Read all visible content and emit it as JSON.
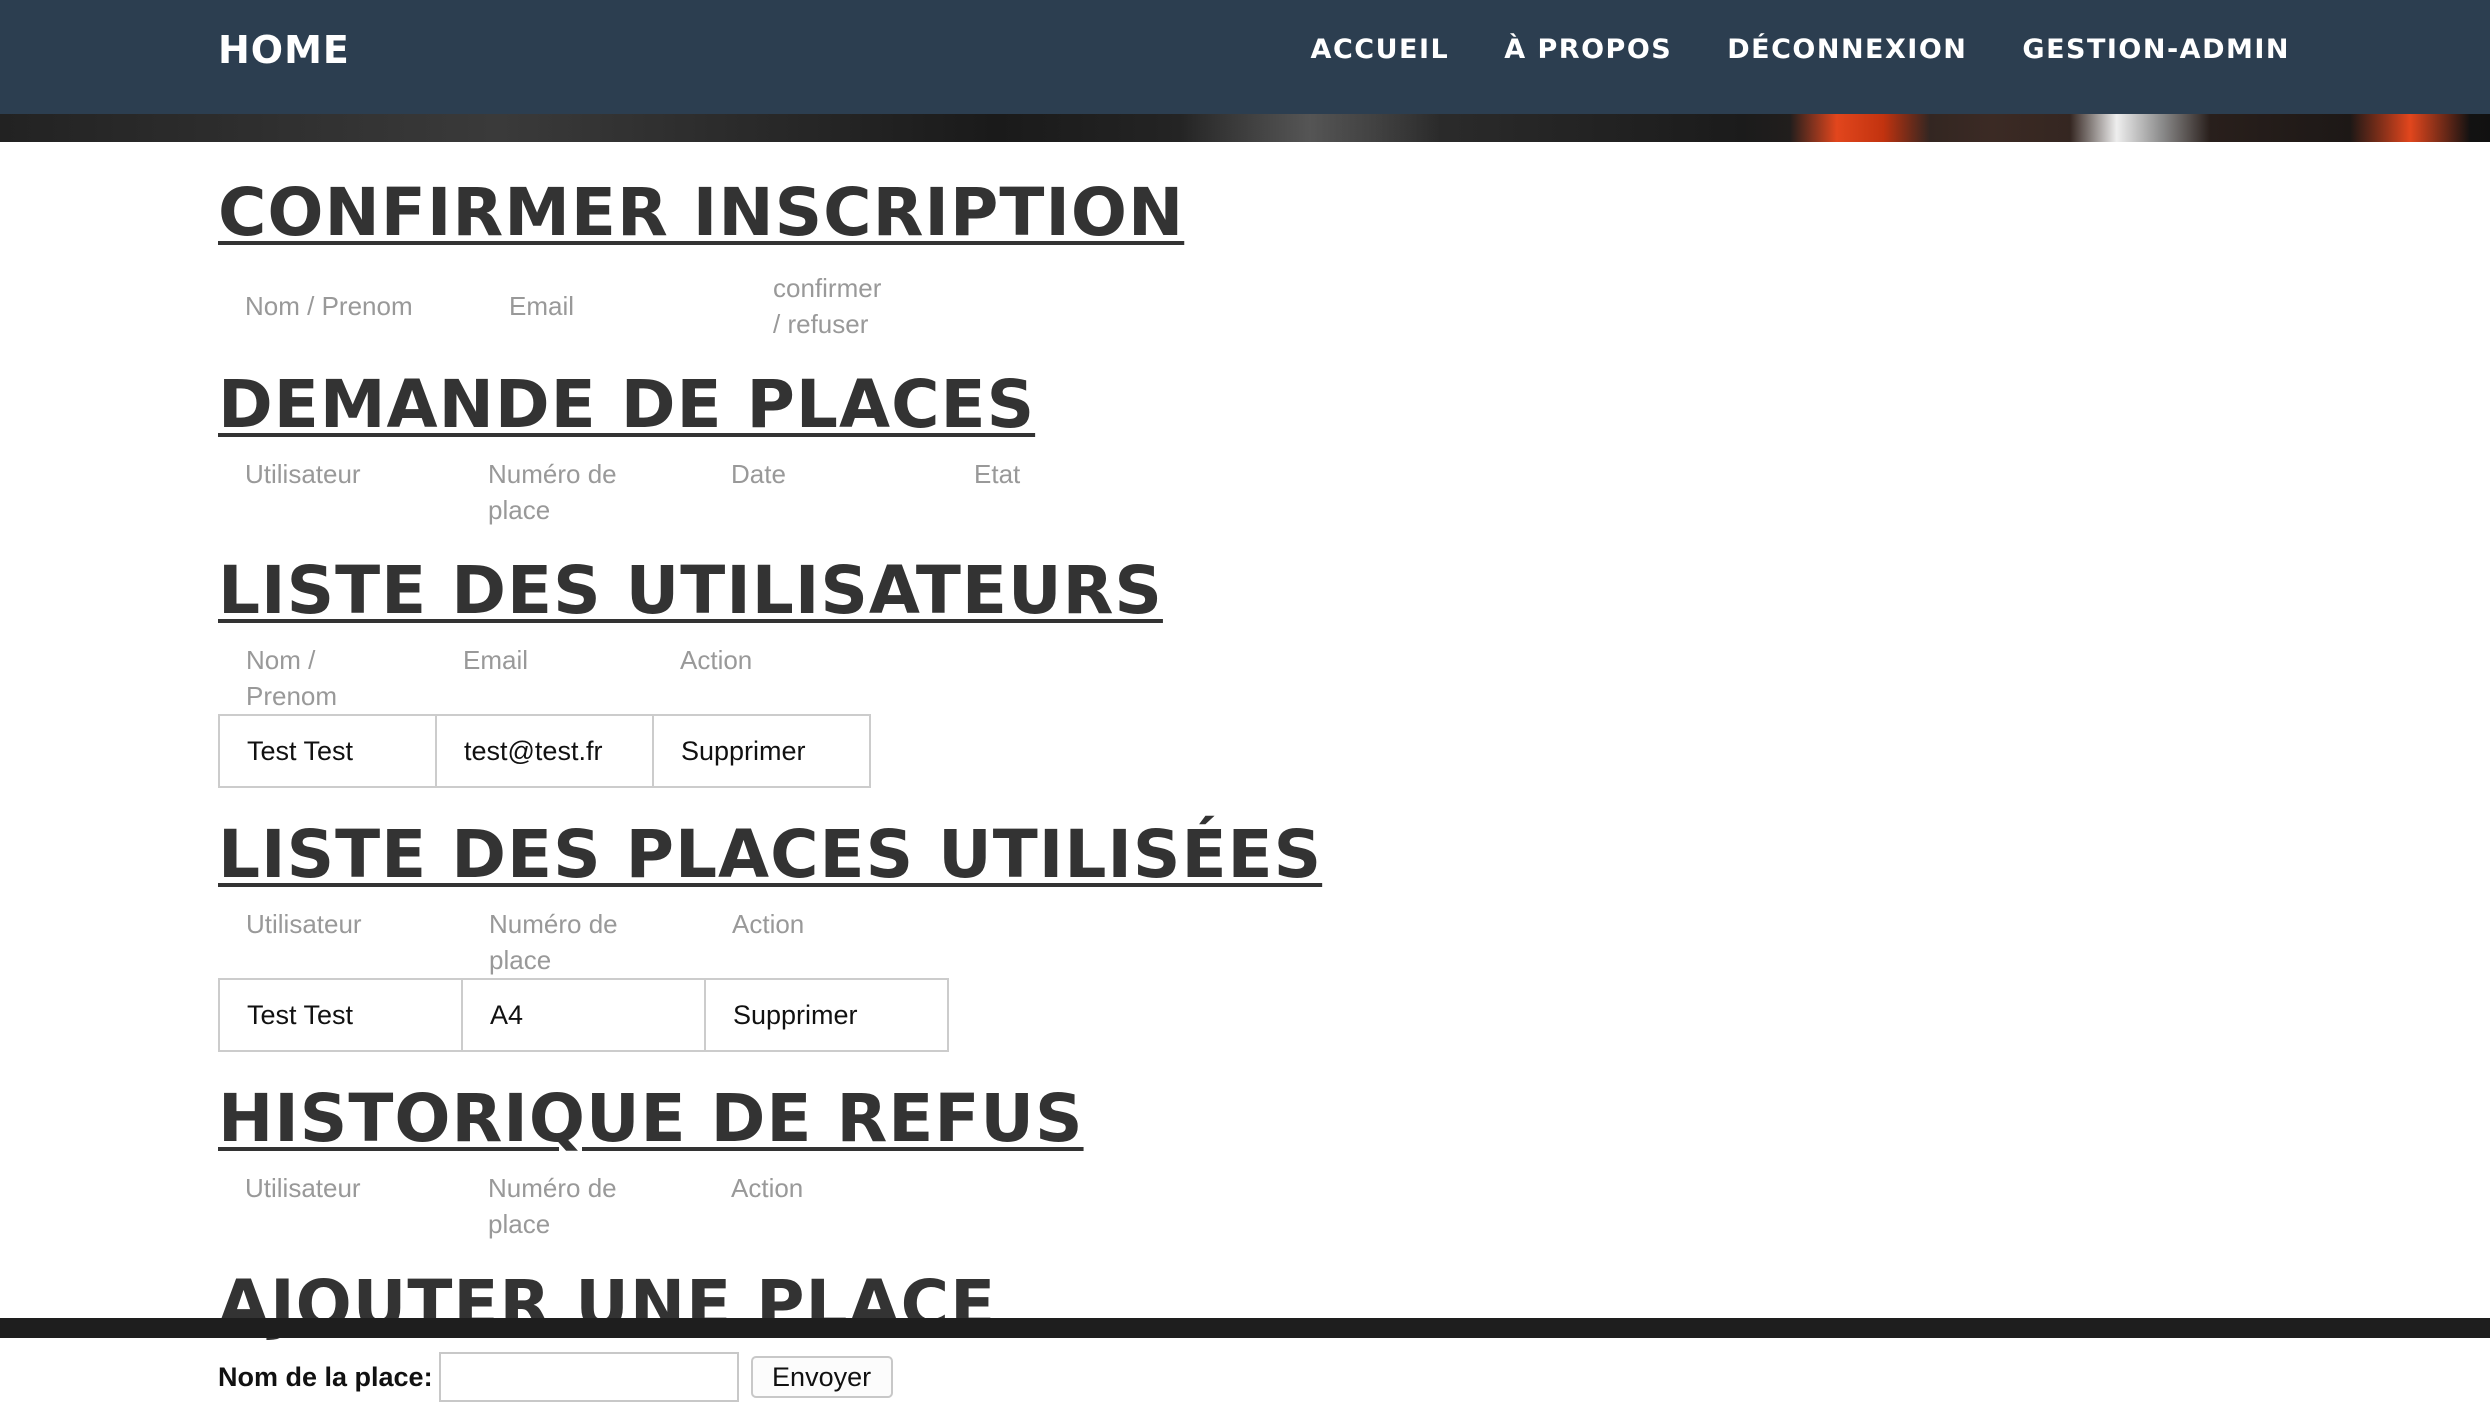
{
  "navbar": {
    "brand": "HOME",
    "links": [
      "ACCUEIL",
      "À PROPOS",
      "DÉCONNEXION",
      "GESTION-ADMIN"
    ],
    "background": "#2c3e50"
  },
  "sections": {
    "confirm": {
      "title": "CONFIRMER INSCRIPTION",
      "headers": [
        "Nom / Prenom",
        "Email",
        "confirmer / refuser"
      ]
    },
    "requests": {
      "title": "DEMANDE DE PLACES",
      "headers": [
        "Utilisateur",
        "Numéro de place",
        "Date",
        "Etat"
      ]
    },
    "users": {
      "title": "LISTE DES UTILISATEURS",
      "headers": [
        "Nom / Prenom",
        "Email",
        "Action"
      ],
      "rows": [
        [
          "Test Test",
          "test@test.fr",
          "Supprimer"
        ]
      ]
    },
    "used_places": {
      "title": "LISTE DES PLACES UTILISÉES",
      "headers": [
        "Utilisateur",
        "Numéro de place",
        "Action"
      ],
      "rows": [
        [
          "Test Test",
          "A4",
          "Supprimer"
        ]
      ]
    },
    "refusals": {
      "title": "HISTORIQUE DE REFUS",
      "headers": [
        "Utilisateur",
        "Numéro de place",
        "Action"
      ]
    },
    "add_place": {
      "title": "AJOUTER UNE PLACE",
      "label": "Nom de la place:",
      "input_value": "",
      "button": "Envoyer"
    }
  },
  "colors": {
    "heading": "#333333",
    "header_text": "#999999",
    "cell_border": "#cccccc"
  }
}
